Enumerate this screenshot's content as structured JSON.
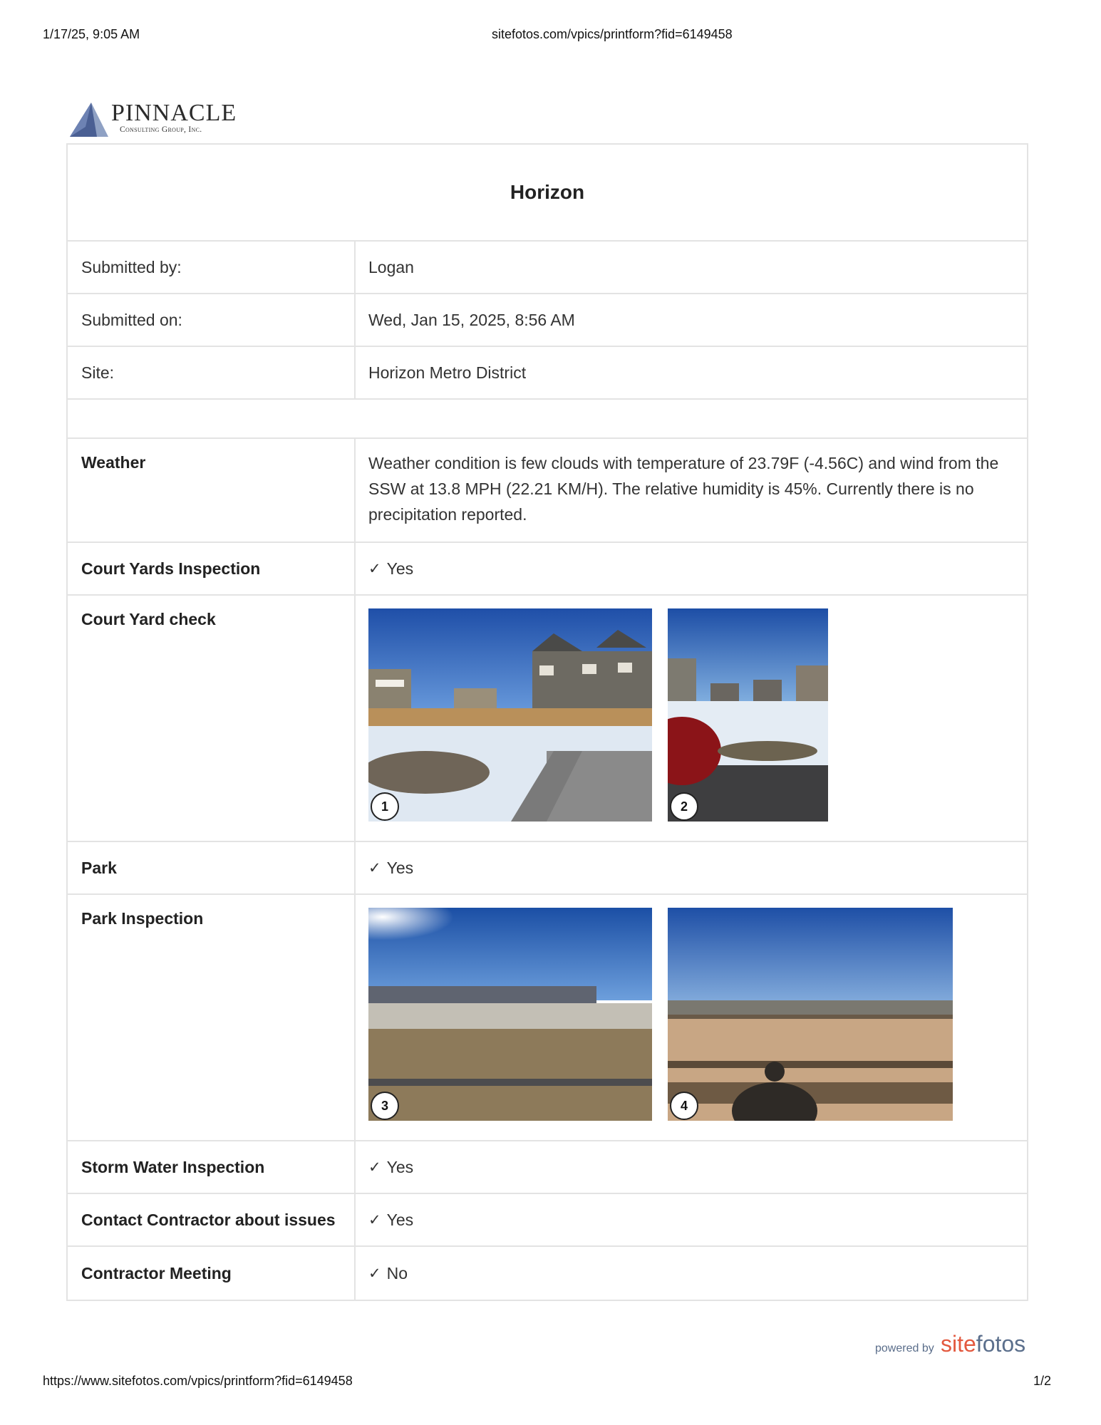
{
  "print_header": {
    "datetime": "1/17/25, 9:05 AM",
    "url": "sitefotos.com/vpics/printform?fid=6149458"
  },
  "logo": {
    "name": "PINNACLE",
    "subtitle": "Consulting Group, Inc."
  },
  "form": {
    "title": "Horizon",
    "meta": [
      {
        "label": "Submitted by:",
        "value": "Logan"
      },
      {
        "label": "Submitted on:",
        "value": "Wed, Jan 15, 2025, 8:56 AM"
      },
      {
        "label": "Site:",
        "value": "Horizon Metro District"
      }
    ],
    "weather": {
      "label": "Weather",
      "value": "Weather condition is few clouds with temperature of 23.79F (-4.56C) and wind from the SSW at 13.8 MPH (22.21 KM/H). The relative humidity is 45%. Currently there is no precipitation reported."
    },
    "court_yards_inspection": {
      "label": "Court Yards Inspection",
      "check": "✓",
      "value": "Yes"
    },
    "court_yard_check": {
      "label": "Court Yard check",
      "photos": [
        "1",
        "2"
      ]
    },
    "park": {
      "label": "Park",
      "check": "✓",
      "value": "Yes"
    },
    "park_inspection": {
      "label": "Park Inspection",
      "photos": [
        "3",
        "4"
      ]
    },
    "storm_water_inspection": {
      "label": "Storm Water Inspection",
      "check": "✓",
      "value": "Yes"
    },
    "contact_contractor": {
      "label": "Contact Contractor about issues",
      "check": "✓",
      "value": "Yes"
    },
    "contractor_meeting": {
      "label": "Contractor Meeting",
      "check": "✓",
      "value": "No"
    }
  },
  "powered_by": {
    "prefix": "powered by",
    "brand_site": "site",
    "brand_fotos": "fotos"
  },
  "print_footer": {
    "url": "https://www.sitefotos.com/vpics/printform?fid=6149458",
    "page": "1/2"
  }
}
